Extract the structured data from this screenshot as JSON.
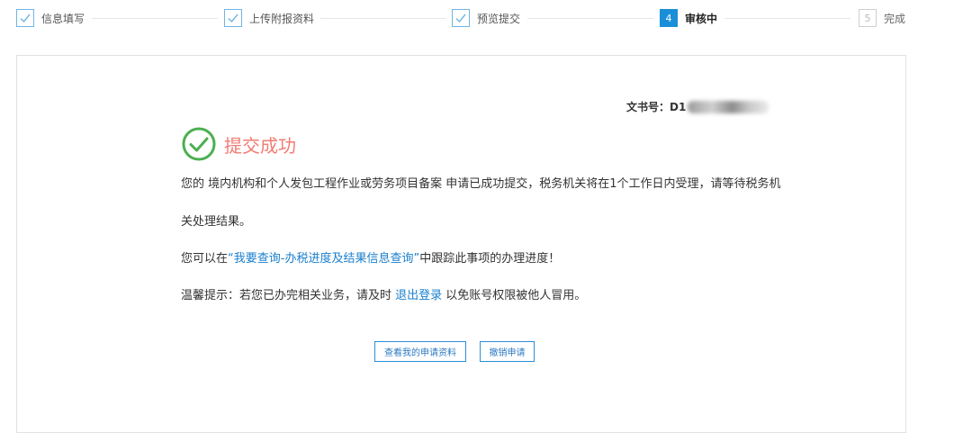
{
  "steps": [
    {
      "state": "done",
      "label": "信息填写"
    },
    {
      "state": "done",
      "label": "上传附报资料"
    },
    {
      "state": "done",
      "label": "预览提交"
    },
    {
      "state": "active",
      "number": "4",
      "label": "审核中"
    },
    {
      "state": "future",
      "number": "5",
      "label": "完成"
    }
  ],
  "doc": {
    "label": "文书号：D1"
  },
  "result": {
    "title": "提交成功",
    "line1": "您的 境内机构和个人发包工程作业或劳务项目备案 申请已成功提交，税务机关将在1个工作日内受理，请等待税务机",
    "line2": "关处理结果。",
    "line3_prefix": "您可以在",
    "line3_link": "“我要查询-办税进度及结果信息查询”",
    "line3_suffix": "中跟踪此事项的办理进度！",
    "line4_prefix": "温馨提示：若您已办完相关业务，请及时 ",
    "line4_link": "退出登录",
    "line4_suffix": " 以免账号权限被他人冒用。"
  },
  "buttons": {
    "view": "查看我的申请资料",
    "cancel": "撤销申请"
  },
  "colors": {
    "accent": "#1a8fd8",
    "success": "#4caf50",
    "title": "#f07c74",
    "link": "#1a7fcc"
  }
}
